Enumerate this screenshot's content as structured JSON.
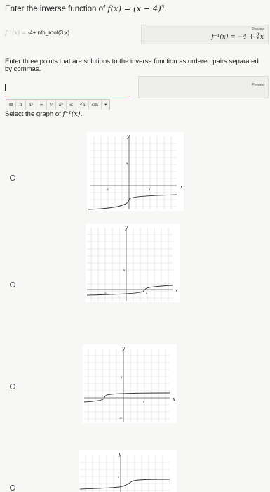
{
  "question1": {
    "text": "Enter the inverse function of ",
    "formula": "f(x) = (x + 4)³."
  },
  "answer": {
    "label": "f⁻¹(x) =",
    "value": "-4+ nth_root(3,x)"
  },
  "preview1": {
    "tag": "Preview",
    "math": "f⁻¹(x) = −4 + ∛x"
  },
  "question2": {
    "text": "Enter three points that are solutions to the inverse function as ordered pairs separated by commas."
  },
  "preview2": {
    "tag": "Preview"
  },
  "toolbar": {
    "items": [
      "⊟",
      "π",
      "aⁿ",
      "∞",
      "⅟",
      "aᵇ",
      "≤",
      "√a",
      "sin",
      "▾"
    ]
  },
  "question3": {
    "text": "Select the graph of ",
    "formula": "f⁻¹(x)."
  },
  "graph_labels": {
    "x": "x",
    "y": "y",
    "neg5": "-5",
    "pos5": "5"
  },
  "options": [
    "option-1",
    "option-2",
    "option-3",
    "option-4"
  ]
}
